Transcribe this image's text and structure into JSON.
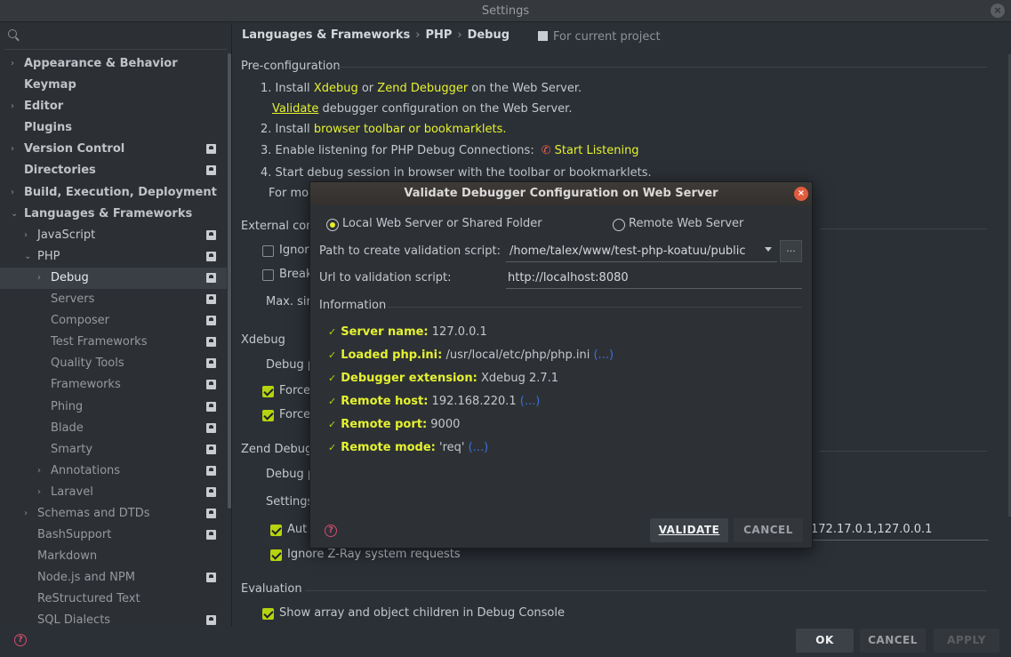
{
  "window": {
    "title": "Settings"
  },
  "sidebar": {
    "search_placeholder": "",
    "items": [
      {
        "label": "Appearance & Behavior",
        "level": 0,
        "arrow": "›",
        "bold": true,
        "proj": false
      },
      {
        "label": "Keymap",
        "level": 0,
        "arrow": "",
        "bold": true,
        "proj": false
      },
      {
        "label": "Editor",
        "level": 0,
        "arrow": "›",
        "bold": true,
        "proj": false
      },
      {
        "label": "Plugins",
        "level": 0,
        "arrow": "",
        "bold": true,
        "proj": false
      },
      {
        "label": "Version Control",
        "level": 0,
        "arrow": "›",
        "bold": true,
        "proj": true
      },
      {
        "label": "Directories",
        "level": 0,
        "arrow": "",
        "bold": true,
        "proj": true
      },
      {
        "label": "Build, Execution, Deployment",
        "level": 0,
        "arrow": "›",
        "bold": true,
        "proj": false
      },
      {
        "label": "Languages & Frameworks",
        "level": 0,
        "arrow": "⌄",
        "bold": true,
        "proj": false
      },
      {
        "label": "JavaScript",
        "level": 1,
        "arrow": "›",
        "bold": false,
        "proj": true
      },
      {
        "label": "PHP",
        "level": 1,
        "arrow": "⌄",
        "bold": false,
        "proj": true
      },
      {
        "label": "Debug",
        "level": 2,
        "arrow": "›",
        "bold": false,
        "proj": true,
        "selected": true
      },
      {
        "label": "Servers",
        "level": 2,
        "arrow": "",
        "bold": false,
        "proj": true,
        "dim": true
      },
      {
        "label": "Composer",
        "level": 2,
        "arrow": "",
        "bold": false,
        "proj": true,
        "dim": true
      },
      {
        "label": "Test Frameworks",
        "level": 2,
        "arrow": "",
        "bold": false,
        "proj": true,
        "dim": true
      },
      {
        "label": "Quality Tools",
        "level": 2,
        "arrow": "",
        "bold": false,
        "proj": true,
        "dim": true
      },
      {
        "label": "Frameworks",
        "level": 2,
        "arrow": "",
        "bold": false,
        "proj": true,
        "dim": true
      },
      {
        "label": "Phing",
        "level": 2,
        "arrow": "",
        "bold": false,
        "proj": true,
        "dim": true
      },
      {
        "label": "Blade",
        "level": 2,
        "arrow": "",
        "bold": false,
        "proj": true,
        "dim": true
      },
      {
        "label": "Smarty",
        "level": 2,
        "arrow": "",
        "bold": false,
        "proj": true,
        "dim": true
      },
      {
        "label": "Annotations",
        "level": 2,
        "arrow": "›",
        "bold": false,
        "proj": true,
        "dim": true
      },
      {
        "label": "Laravel",
        "level": 2,
        "arrow": "›",
        "bold": false,
        "proj": true,
        "dim": true
      },
      {
        "label": "Schemas and DTDs",
        "level": 1,
        "arrow": "›",
        "bold": false,
        "proj": true,
        "dim": true
      },
      {
        "label": "BashSupport",
        "level": 1,
        "arrow": "",
        "bold": false,
        "proj": true,
        "dim": true
      },
      {
        "label": "Markdown",
        "level": 1,
        "arrow": "",
        "bold": false,
        "proj": false,
        "dim": true
      },
      {
        "label": "Node.js and NPM",
        "level": 1,
        "arrow": "",
        "bold": false,
        "proj": true,
        "dim": true
      },
      {
        "label": "ReStructured Text",
        "level": 1,
        "arrow": "",
        "bold": false,
        "proj": false,
        "dim": true
      },
      {
        "label": "SQL Dialects",
        "level": 1,
        "arrow": "",
        "bold": false,
        "proj": true,
        "dim": true
      }
    ]
  },
  "breadcrumb": {
    "a": "Languages & Frameworks",
    "b": "PHP",
    "c": "Debug",
    "sep": "›"
  },
  "for_project": "For current project",
  "preconfig": {
    "title": "Pre-configuration",
    "step1_pre": "1. Install ",
    "xdebug": "Xdebug",
    "or": " or ",
    "zend": "Zend Debugger",
    "step1_post": " on the Web Server.",
    "validate": "Validate",
    "validate_post": " debugger configuration on the Web Server.",
    "step2_pre": "2. Install ",
    "toolbar": "browser toolbar or bookmarklets.",
    "step3": "3. Enable listening for PHP Debug Connections:",
    "start_listening": "Start Listening",
    "step4": "4. Start debug session in browser with the toolbar or bookmarklets.",
    "formore": "For mo"
  },
  "external": {
    "title": "External conn",
    "ignore": "Ignor",
    "break": "Break",
    "maxsim": "Max. sir"
  },
  "xdebug": {
    "title": "Xdebug",
    "debug_port": "Debug p",
    "force1": "Force",
    "force2": "Force"
  },
  "zend": {
    "title": "Zend Debugg",
    "debug_port": "Debug p",
    "settings": "Settings",
    "aut": "Aut",
    "allowed": "172.17.0.1,127.0.0.1",
    "ignore_zray": "Ignore Z-Ray system requests"
  },
  "evaluation": {
    "title": "Evaluation",
    "show_array": "Show array and object children in Debug Console"
  },
  "dialog": {
    "title": "Validate Debugger Configuration on Web Server",
    "close": "×",
    "radio_local": "Local Web Server or Shared Folder",
    "radio_remote": "Remote Web Server",
    "path_label": "Path to create validation script:",
    "path_value": "/home/talex/www/test-php-koatuu/public",
    "browse": "...",
    "url_label": "Url to validation script:",
    "url_value": "http://localhost:8080",
    "info_title": "Information",
    "info": [
      {
        "key": "Server name:",
        "val": " 127.0.0.1",
        "more": ""
      },
      {
        "key": "Loaded php.ini:",
        "val": " /usr/local/etc/php/php.ini ",
        "more": "(...)"
      },
      {
        "key": "Debugger extension:",
        "val": " Xdebug 2.7.1",
        "more": ""
      },
      {
        "key": "Remote host:",
        "val": " 192.168.220.1 ",
        "more": "(...)"
      },
      {
        "key": "Remote port:",
        "val": " 9000",
        "more": ""
      },
      {
        "key": "Remote mode:",
        "val": " 'req' ",
        "more": "(...)"
      }
    ],
    "validate_btn": "VALIDATE",
    "cancel_btn": "CANCEL"
  },
  "footer": {
    "ok": "OK",
    "cancel": "CANCEL",
    "apply": "APPLY"
  },
  "colors": {
    "accent": "#e5f230",
    "check": "#b6d30f",
    "help": "#d24d6c",
    "close": "#e15c3d"
  }
}
